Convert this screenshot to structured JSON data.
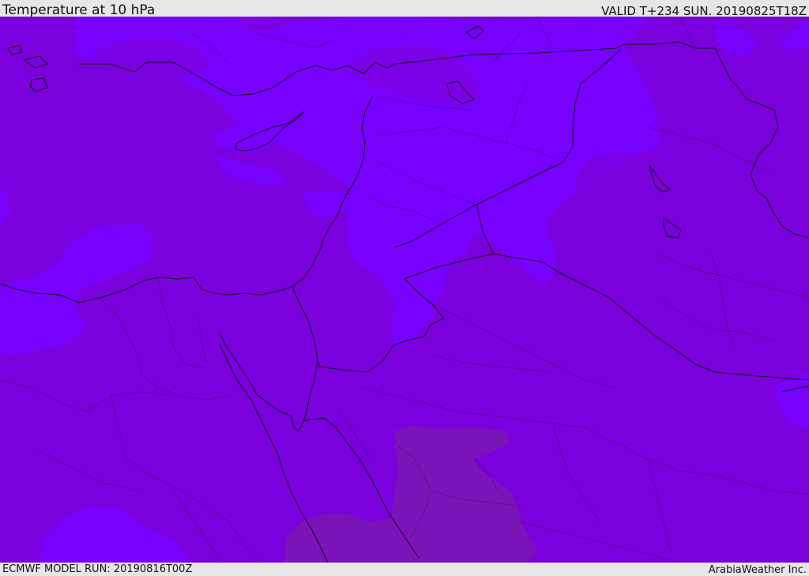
{
  "header": {
    "title": "Temperature at 10 hPa",
    "valid_time": "VALID T+234 SUN. 20190825T18Z"
  },
  "footer": {
    "model_run": "ECMWF MODEL RUN: 20190816T00Z",
    "credit": "ArabiaWeather Inc."
  },
  "map": {
    "field_colors": {
      "base": "#7a00dd",
      "warmer": "#7800ff",
      "coldest": "#7a14b8"
    },
    "border_color": "#111111"
  }
}
